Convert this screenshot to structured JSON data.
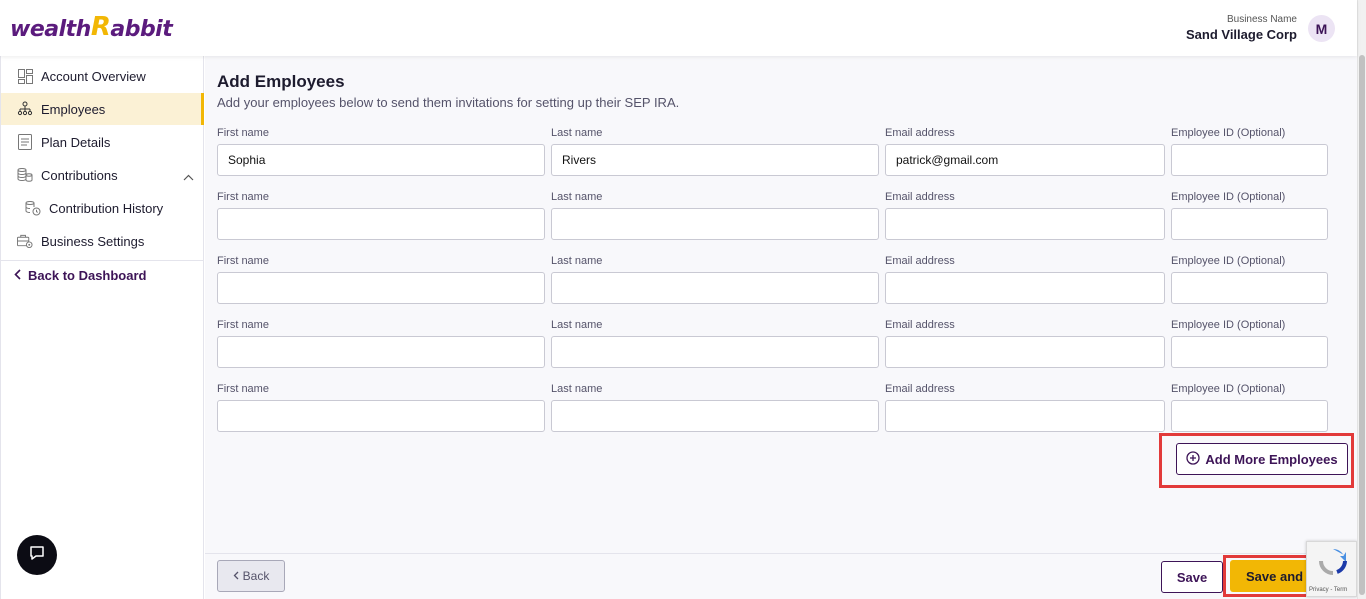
{
  "brand": {
    "logo_prefix": "wealth",
    "logo_r": "R",
    "logo_suffix": "abbit",
    "primary_color": "#3d1457",
    "accent_color": "#f2b705"
  },
  "header": {
    "business_label": "Business Name",
    "business_name": "Sand Village Corp",
    "avatar_initial": "M"
  },
  "sidebar": {
    "items": [
      {
        "label": "Account Overview",
        "icon": "grid-icon"
      },
      {
        "label": "Employees",
        "icon": "org-chart-icon",
        "active": true
      },
      {
        "label": "Plan Details",
        "icon": "document-icon"
      },
      {
        "label": "Contributions",
        "icon": "coins-icon",
        "expanded": true
      },
      {
        "label": "Contribution History",
        "icon": "history-coins-icon",
        "sub": true
      },
      {
        "label": "Business Settings",
        "icon": "briefcase-settings-icon"
      }
    ],
    "back_label": "Back to Dashboard"
  },
  "page": {
    "title": "Add Employees",
    "subtitle": "Add your employees below to send them invitations for setting up their SEP IRA."
  },
  "form": {
    "labels": {
      "first": "First name",
      "last": "Last name",
      "email": "Email address",
      "employee_id": "Employee ID (Optional)"
    },
    "rows": [
      {
        "first": "Sophia",
        "last": "Rivers",
        "email": "patrick@gmail.com",
        "employee_id": ""
      },
      {
        "first": "",
        "last": "",
        "email": "",
        "employee_id": ""
      },
      {
        "first": "",
        "last": "",
        "email": "",
        "employee_id": ""
      },
      {
        "first": "",
        "last": "",
        "email": "",
        "employee_id": ""
      },
      {
        "first": "",
        "last": "",
        "email": "",
        "employee_id": ""
      }
    ],
    "add_more_label": "Add More Employees"
  },
  "footer": {
    "back_label": "Back",
    "save_label": "Save",
    "save_next_label": "Save and N",
    "recaptcha_legal": "Privacy - Term"
  }
}
